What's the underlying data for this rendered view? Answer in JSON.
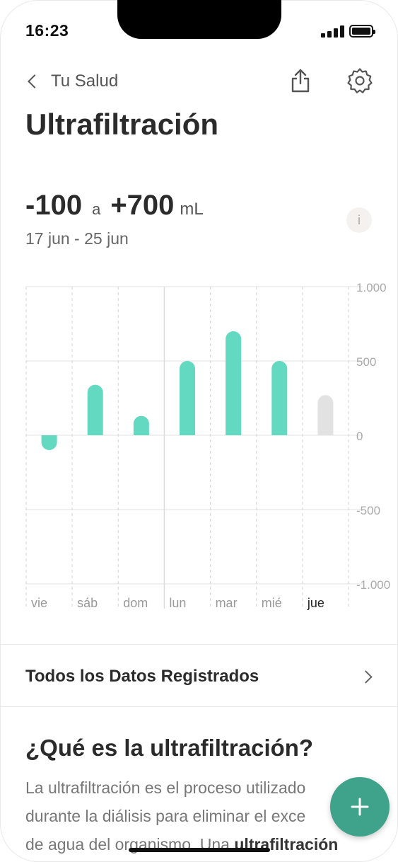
{
  "status_bar": {
    "time": "16:23"
  },
  "nav": {
    "back_label": "Tu Salud"
  },
  "page": {
    "title": "Ultrafiltración"
  },
  "summary": {
    "min_value": "-100",
    "connector": "a",
    "max_value": "+700",
    "unit": "mL",
    "date_range": "17 jun - 25 jun",
    "info_label": "i"
  },
  "chart_data": {
    "type": "bar",
    "categories": [
      "vie",
      "sáb",
      "dom",
      "lun",
      "mar",
      "mié",
      "jue"
    ],
    "values": [
      -100,
      340,
      130,
      500,
      700,
      500,
      270
    ],
    "highlight_category": "jue",
    "y_tick_labels": [
      "1.000",
      "500",
      "0",
      "-500",
      "-1.000"
    ],
    "y_ticks": [
      1000,
      500,
      0,
      -500,
      -1000
    ],
    "ylim": [
      -1000,
      1000
    ],
    "grid": true,
    "colors": {
      "bar": "#62d9c0",
      "bar_current": "#e2e2e2"
    }
  },
  "all_data": {
    "label": "Todos los Datos Registrados"
  },
  "explainer": {
    "title": "¿Qué es la ultrafiltración?",
    "line1": "La ultrafiltración es el proceso utilizado",
    "line2": "durante la diálisis para eliminar el exce",
    "line3_prefix": "de agua del organismo. Una ",
    "line3_bold": "ultrafiltración"
  },
  "fab": {
    "icon": "plus-icon",
    "color": "#3fa28a"
  }
}
